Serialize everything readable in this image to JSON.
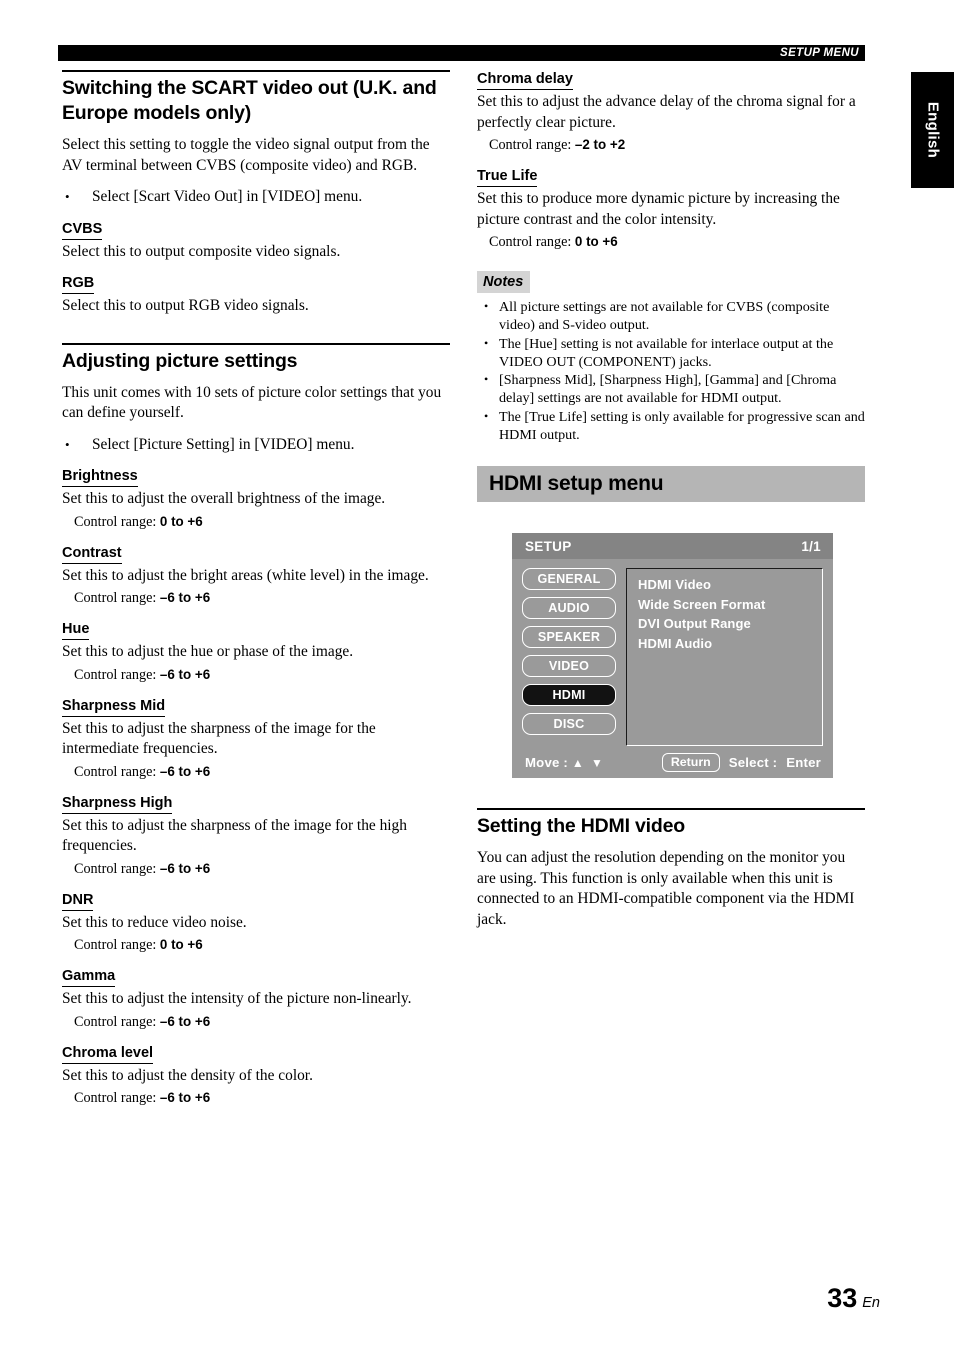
{
  "header": {
    "running_head": "SETUP MENU"
  },
  "language_tab": {
    "label": "English"
  },
  "left_column": {
    "section1": {
      "title": "Switching the SCART video out (U.K. and Europe models only)",
      "intro": "Select this setting to toggle the video signal output from the AV terminal between CVBS (composite video) and RGB.",
      "bullets": [
        "Select [Scart Video Out] in [VIDEO] menu."
      ],
      "items": [
        {
          "heading": "CVBS",
          "body": "Select this to output composite video signals."
        },
        {
          "heading": "RGB",
          "body": "Select this to output RGB video signals."
        }
      ]
    },
    "section2": {
      "title": "Adjusting picture settings",
      "intro": "This unit comes with 10 sets of picture color settings that you can define yourself.",
      "bullets": [
        "Select [Picture Setting] in [VIDEO] menu."
      ],
      "control_range_label": "Control range:",
      "items": [
        {
          "heading": "Brightness",
          "body": "Set this to adjust the overall brightness of the image.",
          "range": "0 to +6"
        },
        {
          "heading": "Contrast",
          "body": "Set this to adjust the bright areas (white level) in the image.",
          "range": "–6 to +6"
        },
        {
          "heading": "Hue",
          "body": "Set this to adjust the hue or phase of the image.",
          "range": "–6 to +6"
        },
        {
          "heading": "Sharpness Mid",
          "body": "Set this to adjust the sharpness of the image for the intermediate frequencies.",
          "range": "–6 to +6"
        },
        {
          "heading": "Sharpness High",
          "body": "Set this to adjust the sharpness of the image for the high frequencies.",
          "range": "–6 to +6"
        },
        {
          "heading": "DNR",
          "body": "Set this to reduce video noise.",
          "range": "0 to +6"
        },
        {
          "heading": "Gamma",
          "body": "Set this to adjust the intensity of the picture non-linearly.",
          "range": "–6 to +6"
        },
        {
          "heading": "Chroma level",
          "body": "Set this to adjust the density of the color.",
          "range": "–6 to +6"
        }
      ]
    }
  },
  "right_column": {
    "control_range_label": "Control range:",
    "items": [
      {
        "heading": "Chroma delay",
        "body": "Set this to adjust the advance delay of the chroma signal for a perfectly clear picture.",
        "range": "–2 to +2"
      },
      {
        "heading": "True Life",
        "body": "Set this to produce more dynamic picture by increasing the picture contrast and the color intensity.",
        "range": "0 to +6"
      }
    ],
    "notes": {
      "label": "Notes",
      "items": [
        "All picture settings are not available for CVBS (composite video) and S-video output.",
        "The [Hue] setting is not available for interlace output at the VIDEO OUT (COMPONENT) jacks.",
        "[Sharpness Mid], [Sharpness High], [Gamma] and [Chroma delay] settings are not available for HDMI output.",
        "The [True Life] setting is only available for progressive scan and HDMI output."
      ]
    },
    "banner": {
      "title": "HDMI setup menu"
    },
    "osd": {
      "title": "SETUP",
      "page_indicator": "1/1",
      "tabs": [
        {
          "label": "GENERAL",
          "selected": false
        },
        {
          "label": "AUDIO",
          "selected": false
        },
        {
          "label": "SPEAKER",
          "selected": false
        },
        {
          "label": "VIDEO",
          "selected": false
        },
        {
          "label": "HDMI",
          "selected": true
        },
        {
          "label": "DISC",
          "selected": false
        }
      ],
      "list_items": [
        "HDMI Video",
        "Wide Screen Format",
        "DVI Output Range",
        "HDMI Audio"
      ],
      "footer": {
        "move_label": "Move :",
        "move_arrows": "▲ ▼",
        "return_label": "Return",
        "select_label": "Select :",
        "enter_label": "Enter"
      }
    },
    "section3": {
      "title": "Setting the HDMI video",
      "body": "You can adjust the resolution depending on the monitor you are using. This function is only available when this unit is connected to an HDMI-compatible component via the HDMI jack."
    }
  },
  "footer": {
    "page_number": "33",
    "lang_code": "En"
  },
  "colors": {
    "banner_gray": "#b5b5b5",
    "notes_gray": "#d4d4d4",
    "osd_body": "#9a9a9a",
    "osd_titlebar": "#848484",
    "osd_selected": "#121212"
  }
}
